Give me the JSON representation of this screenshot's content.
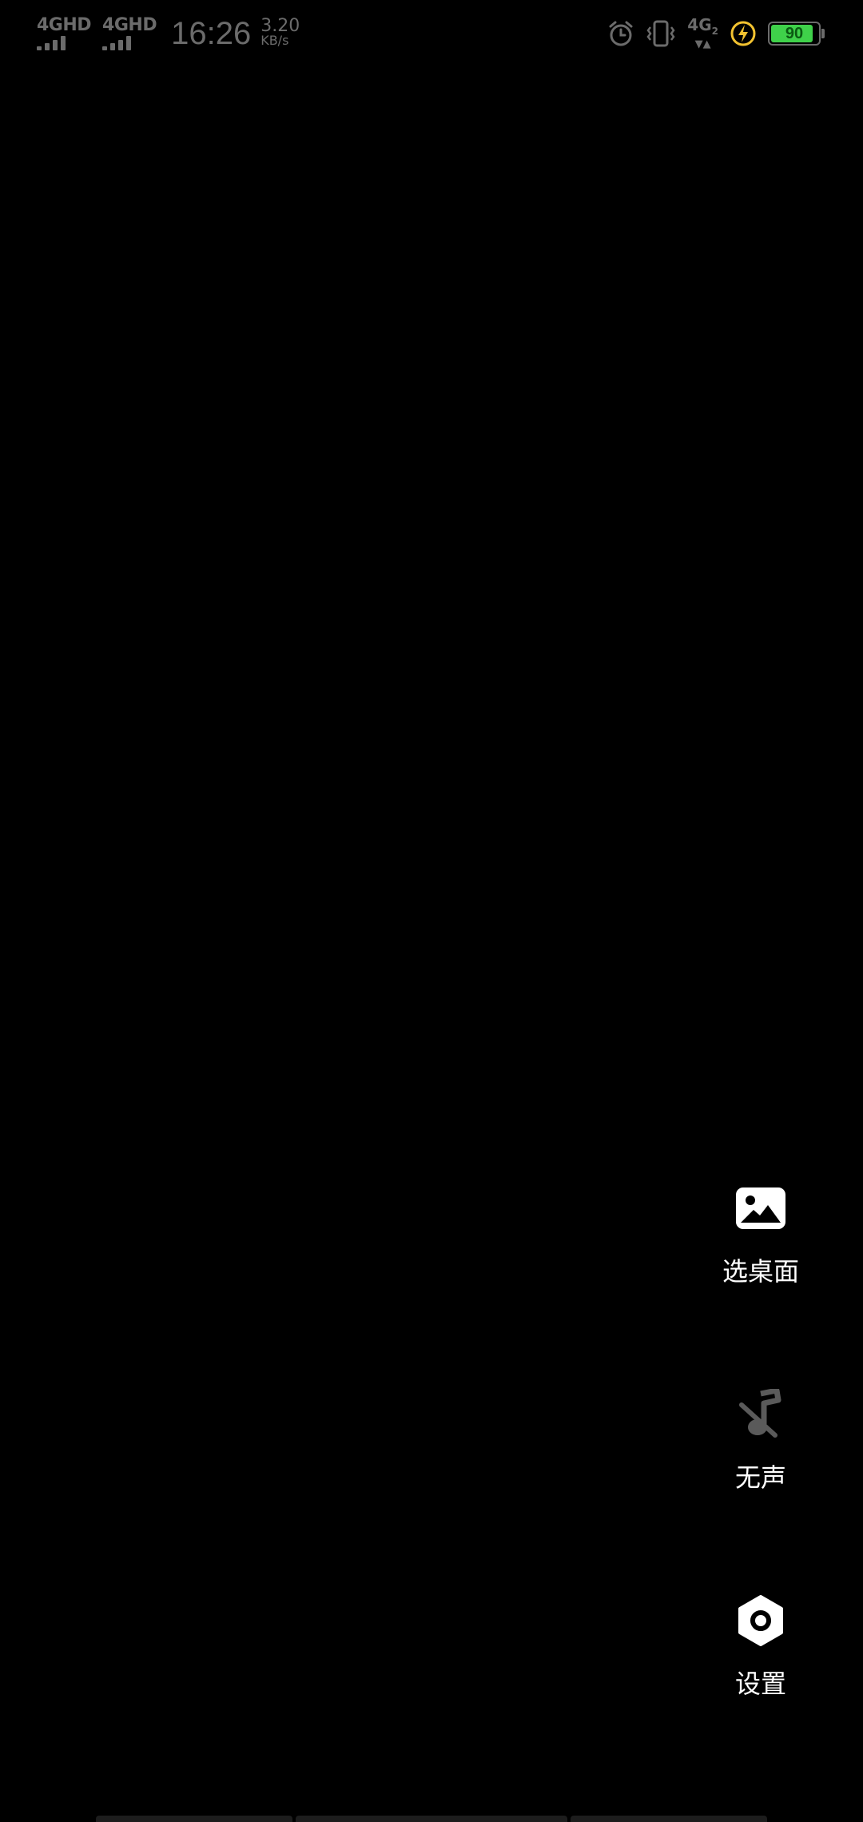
{
  "status_bar": {
    "network_1": {
      "label": "4GHD",
      "bars_level": 4
    },
    "network_2": {
      "label": "4GHD",
      "bars_level": 4
    },
    "time": "16:26",
    "speed_value": "3.20",
    "speed_unit": "KB/s",
    "icons": [
      "alarm-icon",
      "vibrate-icon",
      "network-4g-icon",
      "charging-icon",
      "battery-icon"
    ],
    "network_right": {
      "label": "4G",
      "sub": "2",
      "arrows": "▼▲"
    },
    "battery": {
      "percent": 90,
      "fill_fraction": 0.9,
      "fill_color": "#3fd14a"
    }
  },
  "actions": [
    {
      "id": "wallpaper",
      "icon": "image-icon",
      "label": "选桌面"
    },
    {
      "id": "mute",
      "icon": "music-off-icon",
      "label": "无声"
    },
    {
      "id": "settings",
      "icon": "settings-hex-icon",
      "label": "设置"
    }
  ],
  "colors": {
    "background": "#000000",
    "status_text": "#6b6b6b",
    "label_text": "#ffffff",
    "muted_icon": "#5a5a5a",
    "charge_bolt": "#f2c230"
  }
}
